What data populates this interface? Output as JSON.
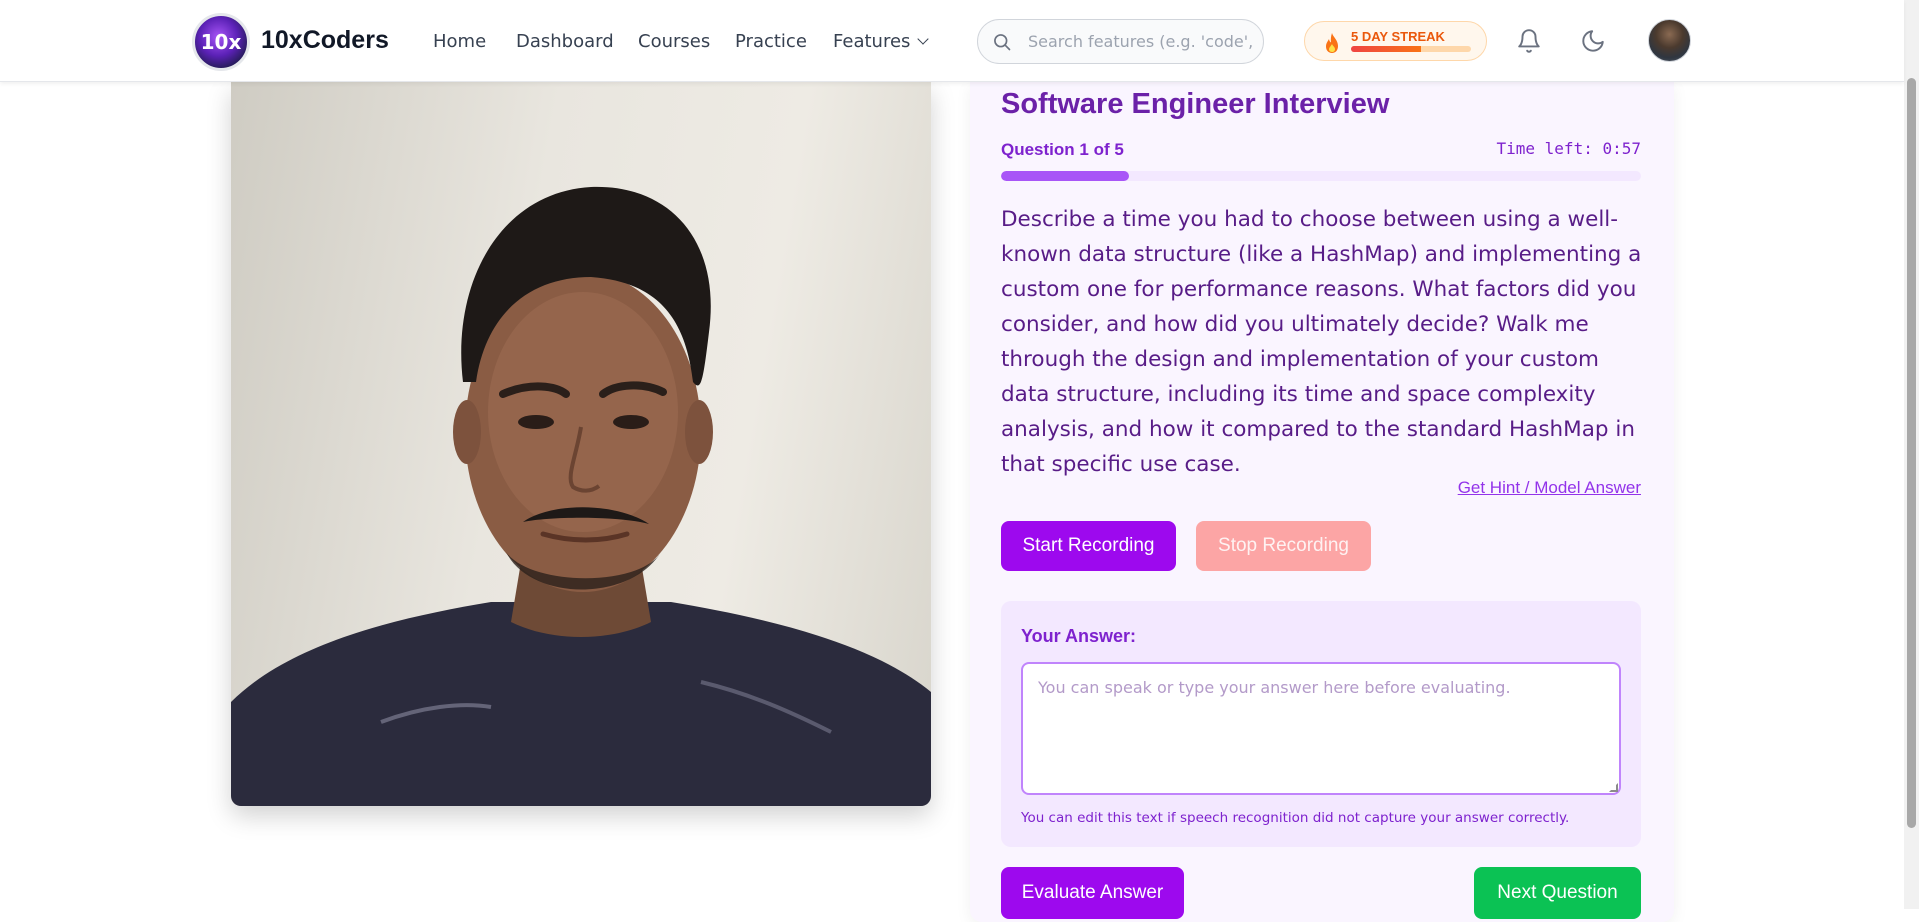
{
  "header": {
    "brand": "10xCoders",
    "logo_text": "10x",
    "nav": [
      {
        "label": "Home"
      },
      {
        "label": "Dashboard"
      },
      {
        "label": "Courses"
      },
      {
        "label": "Practice"
      },
      {
        "label": "Features"
      }
    ],
    "search_placeholder": "Search features (e.g. 'code', '",
    "streak": {
      "label": "5 DAY STREAK",
      "progress": 0.58
    },
    "icons": {
      "search": "search-icon",
      "bell": "bell-icon",
      "theme": "moon-icon",
      "streak": "flame-icon",
      "dropdown": "chevron-down-icon"
    }
  },
  "interview": {
    "title": "Software Engineer Interview",
    "question_counter": "Question 1 of 5",
    "timer": "Time left: 0:57",
    "progress": 0.2,
    "question": "Describe a time you had to choose between using a well-known data structure (like a HashMap) and implementing a custom one for performance reasons. What factors did you consider, and how did you ultimately decide? Walk me through the design and implementation of your custom data structure, including its time and space complexity analysis, and how it compared to the standard HashMap in that specific use case.",
    "hint_link": "Get Hint / Model Answer",
    "start_label": "Start Recording",
    "stop_label": "Stop Recording",
    "answer_label": "Your Answer:",
    "answer_value": "",
    "answer_placeholder": "You can speak or type your answer here before evaluating.",
    "answer_note": "You can edit this text if speech recognition did not capture your answer correctly.",
    "evaluate_label": "Evaluate Answer",
    "next_label": "Next Question"
  },
  "colors": {
    "accent": "#9d09ee",
    "title": "#6b21a8",
    "stop": "#fca5a5",
    "next": "#0bc254",
    "streak": "#ea580c"
  }
}
